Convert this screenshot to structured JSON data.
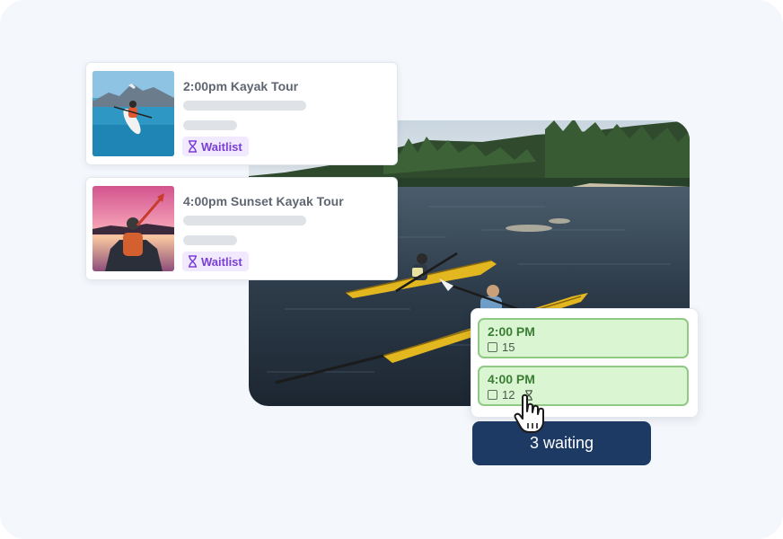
{
  "tours": [
    {
      "title": "2:00pm Kayak Tour",
      "status": "Waitlist",
      "thumb_icon": "kayak-mountain-lake-photo"
    },
    {
      "title": "4:00pm Sunset Kayak Tour",
      "status": "Waitlist",
      "thumb_icon": "sunset-kayak-photo"
    }
  ],
  "slots": [
    {
      "time": "2:00 PM",
      "capacity": "15"
    },
    {
      "time": "4:00 PM",
      "capacity": "12"
    }
  ],
  "tooltip": {
    "text": "3 waiting"
  },
  "colors": {
    "accent_purple": "#7a3fd6",
    "slot_green": "#d9f5d2",
    "slot_border": "#8fc983",
    "tooltip_bg": "#1c3a63"
  }
}
